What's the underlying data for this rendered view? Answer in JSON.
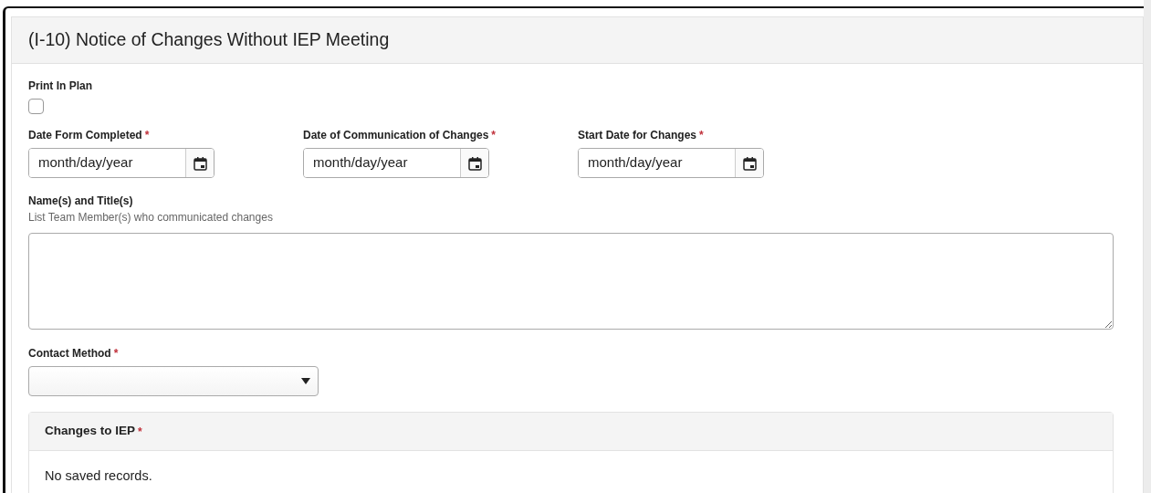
{
  "title": "(I-10) Notice of Changes Without IEP Meeting",
  "print_in_plan": {
    "label": "Print In Plan",
    "checked": false
  },
  "date_fields": [
    {
      "label": "Date Form Completed",
      "required_mark": "*",
      "placeholder": "month/day/year"
    },
    {
      "label": "Date of Communication of Changes",
      "required_mark": "*",
      "placeholder": "month/day/year"
    },
    {
      "label": "Start Date for Changes",
      "required_mark": "*",
      "placeholder": "month/day/year"
    }
  ],
  "names": {
    "label": "Name(s) and Title(s)",
    "hint": "List Team Member(s) who communicated changes"
  },
  "contact_method": {
    "label": "Contact Method",
    "required_mark": "*"
  },
  "changes": {
    "title": "Changes to IEP",
    "required_mark": "*",
    "empty_text": "No saved records."
  }
}
